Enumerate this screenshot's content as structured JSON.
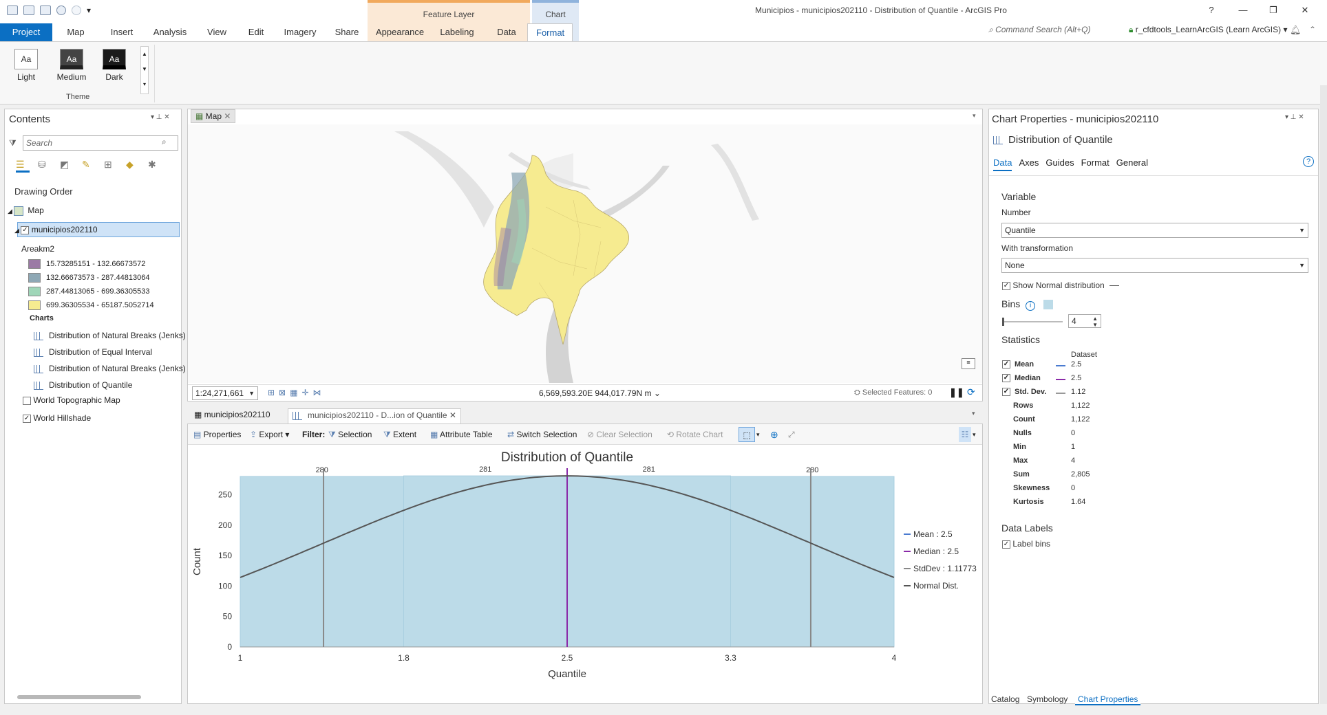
{
  "window": {
    "title": "Municipios - municipios202110 - Distribution of Quantile - ArcGIS Pro",
    "help": "?",
    "minimize": "—",
    "restore": "❐",
    "close": "✕"
  },
  "context_tabs": {
    "feature_layer": "Feature Layer",
    "chart": "Chart"
  },
  "ribbon_tabs": [
    "Project",
    "Map",
    "Insert",
    "Analysis",
    "View",
    "Edit",
    "Imagery",
    "Share",
    "Appearance",
    "Labeling",
    "Data",
    "Format"
  ],
  "command_search": "Command Search (Alt+Q)",
  "user": "r_cfdtools_LearnArcGIS (Learn ArcGIS) ▾",
  "theme": {
    "group_label": "Theme",
    "options": [
      "Light",
      "Medium",
      "Dark"
    ],
    "sample": "Aa"
  },
  "contents": {
    "title": "Contents",
    "search_placeholder": "Search",
    "drawing_order": "Drawing Order",
    "map_label": "Map",
    "layer_name": "municipios202110",
    "field_name": "Areakm2",
    "classes": [
      {
        "label": "15.73285151 - 132.66673572",
        "color": "#9b7aa5"
      },
      {
        "label": "132.66673573 - 287.44813064",
        "color": "#8ea8b5"
      },
      {
        "label": "287.44813065 - 699.36305533",
        "color": "#9fd6b8"
      },
      {
        "label": "699.36305534 - 65187.5052714",
        "color": "#f6eb90"
      }
    ],
    "charts_heading": "Charts",
    "charts": [
      "Distribution of Natural Breaks (Jenks)",
      "Distribution of Equal Interval",
      "Distribution of Natural Breaks (Jenks)",
      "Distribution of Quantile"
    ],
    "basemaps": [
      {
        "label": "World Topographic Map",
        "checked": false
      },
      {
        "label": "World Hillshade",
        "checked": true
      }
    ]
  },
  "map_view": {
    "tab": "Map",
    "scale": "1:24,271,661",
    "coords": "6,569,593.20E 944,017.79N m",
    "selected": "Selected Features: 0"
  },
  "chart_view": {
    "tabs": [
      "municipios202110",
      "municipios202110 - D...ion of Quantile"
    ],
    "toolbar": {
      "properties": "Properties",
      "export": "Export",
      "filter": "Filter:",
      "selection": "Selection",
      "extent": "Extent",
      "attribute_table": "Attribute Table",
      "switch_selection": "Switch Selection",
      "clear_selection": "Clear Selection",
      "rotate_chart": "Rotate Chart"
    }
  },
  "chart_data": {
    "type": "bar",
    "title": "Distribution of Quantile",
    "xlabel": "Quantile",
    "ylabel": "Count",
    "bin_edges": [
      1,
      1.75,
      2.5,
      3.25,
      4
    ],
    "x_tick_labels": [
      "1",
      "1.8",
      "2.5",
      "3.3",
      "4"
    ],
    "values": [
      280,
      281,
      281,
      280
    ],
    "data_labels": [
      "280",
      "281",
      "281",
      "280"
    ],
    "ylim": [
      0,
      280
    ],
    "yticks": [
      0,
      50,
      100,
      150,
      200,
      250
    ],
    "xlim": [
      1,
      4
    ],
    "mean": 2.5,
    "median": 2.5,
    "stddev": 1.11773,
    "normal_curve": {
      "mean": 2.5,
      "std": 1.11773,
      "peak": 281
    },
    "legend": [
      {
        "label": "Mean : 2.5",
        "color": "#4a7bd0"
      },
      {
        "label": "Median : 2.5",
        "color": "#8a2aa8"
      },
      {
        "label": "StdDev : 1.11773",
        "color": "#888888"
      },
      {
        "label": "Normal Dist.",
        "color": "#555555"
      }
    ],
    "bar_color": "#bcdbe8"
  },
  "chart_properties": {
    "title": "Chart Properties - municipios202110",
    "chart_name": "Distribution of Quantile",
    "tabs": [
      "Data",
      "Axes",
      "Guides",
      "Format",
      "General"
    ],
    "variable_heading": "Variable",
    "number_label": "Number",
    "number_value": "Quantile",
    "transformation_label": "With transformation",
    "transformation_value": "None",
    "show_normal": "Show Normal distribution",
    "bins_heading": "Bins",
    "bins_value": "4",
    "statistics_heading": "Statistics",
    "dataset_label": "Dataset",
    "stats": [
      {
        "name": "Mean",
        "value": "2.5",
        "check": true,
        "line": "#4a7bd0"
      },
      {
        "name": "Median",
        "value": "2.5",
        "check": true,
        "line": "#8a2aa8"
      },
      {
        "name": "Std. Dev.",
        "value": "1.12",
        "check": true,
        "line": "#999999"
      },
      {
        "name": "Rows",
        "value": "1,122"
      },
      {
        "name": "Count",
        "value": "1,122"
      },
      {
        "name": "Nulls",
        "value": "0"
      },
      {
        "name": "Min",
        "value": "1"
      },
      {
        "name": "Max",
        "value": "4"
      },
      {
        "name": "Sum",
        "value": "2,805"
      },
      {
        "name": "Skewness",
        "value": "0"
      },
      {
        "name": "Kurtosis",
        "value": "1.64"
      }
    ],
    "data_labels_heading": "Data Labels",
    "label_bins": "Label bins",
    "bottom_tabs": [
      "Catalog",
      "Symbology",
      "Chart Properties"
    ]
  }
}
